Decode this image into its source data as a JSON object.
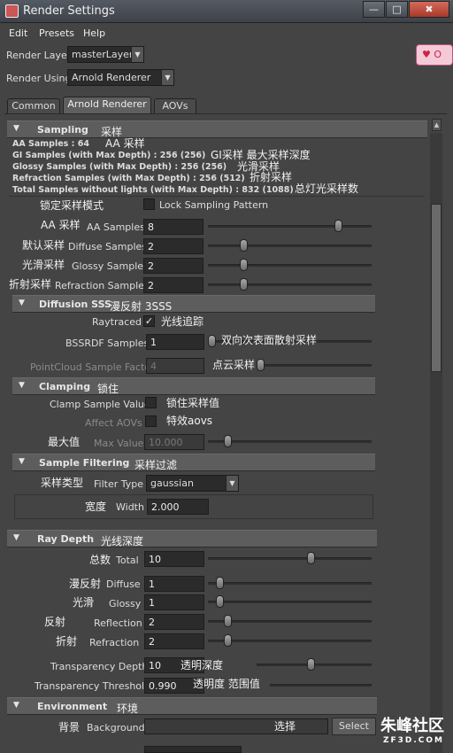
{
  "window": {
    "title": "Render Settings",
    "min": "—",
    "max": "□",
    "close": "✖"
  },
  "menu": [
    "Edit",
    "Presets",
    "Help"
  ],
  "render_layer": {
    "label": "Render Layer",
    "value": "masterLayer"
  },
  "render_using": {
    "label": "Render Using",
    "value": "Arnold Renderer"
  },
  "logo_badge": "♥ O",
  "tabs": [
    "Common",
    "Arnold Renderer",
    "AOVs"
  ],
  "sampling": {
    "title": "Sampling",
    "zh": "采样",
    "info": [
      {
        "text": "AA Samples : 64",
        "zh": "AA 采样"
      },
      {
        "text": "GI Samples (with Max Depth) : 256 (256)",
        "zh": "GI采样  最大采样深度"
      },
      {
        "text": "Glossy Samples (with Max Depth) : 256 (256)",
        "zh": "光滑采样"
      },
      {
        "text": "Refraction Samples (with Max Depth) : 256 (512)",
        "zh": "折射采样"
      },
      {
        "text": "Total Samples without lights (with Max Depth) : 832 (1088)",
        "zh": "总灯光采样数"
      }
    ],
    "lock": {
      "zh": "锁定采样模式",
      "label": "Lock Sampling Pattern"
    },
    "rows": [
      {
        "zh": "AA 采样",
        "label": "AA Samples",
        "value": "8",
        "slider": 0.95
      },
      {
        "zh": "默认采样",
        "label": "Diffuse Samples",
        "value": "2",
        "slider": 0.2
      },
      {
        "zh": "光滑采样",
        "label": "Glossy Samples",
        "value": "2",
        "slider": 0.2
      },
      {
        "zh": "折射采样",
        "label": "Refraction Samples",
        "value": "2",
        "slider": 0.2
      }
    ]
  },
  "diffusion": {
    "title": "Diffusion SSS",
    "zh": "漫反射 3SSS",
    "raytraced": {
      "label": "Raytraced",
      "check": "✓",
      "zh": "光线追踪"
    },
    "bssrdf": {
      "label": "BSSRDF Samples",
      "value": "1",
      "zh": "双向次表面散射采样",
      "slider": 0.0
    },
    "pointcloud": {
      "label": "PointCloud Sample Factor",
      "value": "4",
      "zh": "点云采样",
      "slider": 0.0
    }
  },
  "clamping": {
    "title": "Clamping",
    "zh": "锁住",
    "clamp": {
      "label": "Clamp Sample Values",
      "zh": "锁住采样值"
    },
    "affect": {
      "label": "Affect AOVs",
      "zh": "特效aovs"
    },
    "max": {
      "zh": "最大值",
      "label": "Max Value",
      "value": "10.000",
      "slider": 0.1
    }
  },
  "filter": {
    "title": "Sample Filtering",
    "zh": "采样过滤",
    "type": {
      "zh": "采样类型",
      "label": "Filter Type",
      "value": "gaussian"
    },
    "width": {
      "zh": "宽度",
      "label": "Width",
      "value": "2.000"
    }
  },
  "raydepth": {
    "title": "Ray Depth",
    "zh": "光线深度",
    "rows": [
      {
        "zh": "总数",
        "label": "Total",
        "value": "10",
        "slider": 0.62
      },
      {
        "zh": "漫反射",
        "label": "Diffuse",
        "value": "1",
        "slider": 0.05
      },
      {
        "zh": "光滑",
        "label": "Glossy",
        "value": "1",
        "slider": 0.05
      },
      {
        "zh": "反射",
        "label": "Reflection",
        "value": "2",
        "slider": 0.1
      },
      {
        "zh": "折射",
        "label": "Refraction",
        "value": "2",
        "slider": 0.1
      }
    ],
    "transparency": {
      "label": "Transparency Depth",
      "value": "10",
      "zh": "透明深度",
      "slider": 0.62
    },
    "threshold": {
      "label": "Transparency Threshold",
      "value": "0.990",
      "zh": "透明度  范围值"
    }
  },
  "environment": {
    "title": "Environment",
    "zh": "环境",
    "background": {
      "zh": "背景",
      "label": "Background",
      "select_zh": "选择",
      "button": "Select"
    }
  },
  "watermark": {
    "text": "朱峰社区",
    "sub": "ZF3D.COM"
  }
}
